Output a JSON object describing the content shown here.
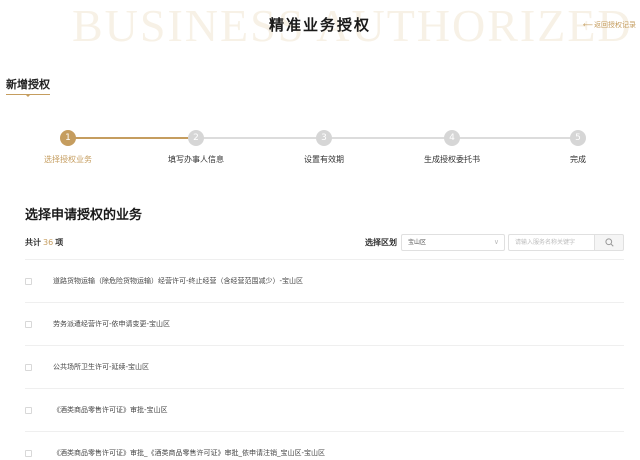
{
  "header": {
    "watermark": "BUSINESS AUTHORIZED",
    "title": "精准业务授权",
    "back_label": "返回授权记录"
  },
  "section_tab": {
    "label": "新增授权"
  },
  "steps": [
    {
      "num": "1",
      "label": "选择授权业务",
      "active": true
    },
    {
      "num": "2",
      "label": "填写办事人信息",
      "active": false
    },
    {
      "num": "3",
      "label": "设置有效期",
      "active": false
    },
    {
      "num": "4",
      "label": "生成授权委托书",
      "active": false
    },
    {
      "num": "5",
      "label": "完成",
      "active": false
    }
  ],
  "main": {
    "heading": "选择申请授权的业务",
    "count_prefix": "共计",
    "count_value": "36",
    "count_suffix": "项"
  },
  "filter": {
    "label": "选择区划",
    "district_value": "宝山区",
    "search_placeholder": "请输入服务名称关键字"
  },
  "items": [
    {
      "text": "道路货物运输（除危险货物运输）经营许可-终止经营（含经营范围减少）-宝山区"
    },
    {
      "text": "劳务派遣经营许可-依申请变更-宝山区"
    },
    {
      "text": "公共场所卫生许可-延续-宝山区"
    },
    {
      "text": "《酒类商品零售许可证》审批-宝山区"
    },
    {
      "text": "《酒类商品零售许可证》审批_《酒类商品零售许可证》审批_依申请注销_宝山区-宝山区"
    }
  ],
  "colors": {
    "accent": "#c59d5f",
    "inactive_step": "#d6d6d6"
  }
}
